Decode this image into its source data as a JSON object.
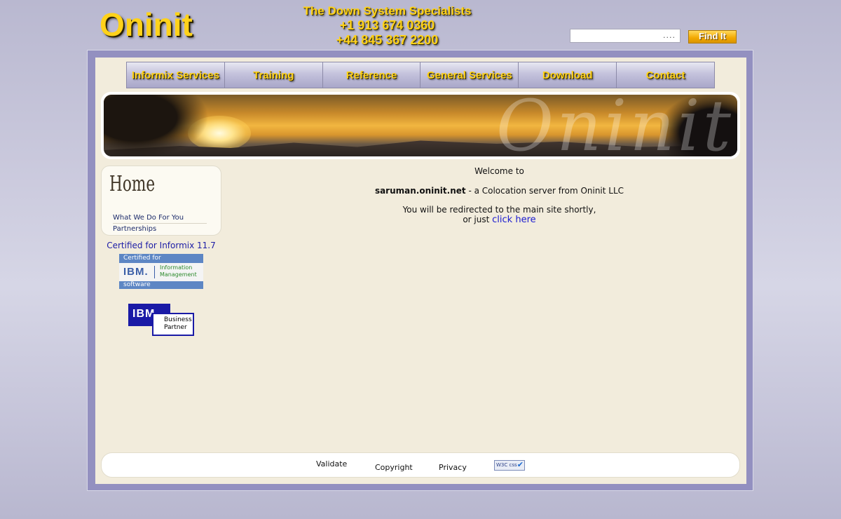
{
  "header": {
    "logo_text": "Oninit",
    "tagline": "The Down System Specialists",
    "phone_us": "+1 913 674 0360",
    "phone_uk": "+44 845 367 2200"
  },
  "search": {
    "value": "....",
    "button_label": "Find It"
  },
  "nav": {
    "items": [
      {
        "label": "Informix Services"
      },
      {
        "label": "Training"
      },
      {
        "label": "Reference"
      },
      {
        "label": "General Services"
      },
      {
        "label": "Download"
      },
      {
        "label": "Contact"
      }
    ]
  },
  "banner": {
    "watermark": "Oninit"
  },
  "sidebar": {
    "title": "Home",
    "links": [
      {
        "label": "What We Do For You"
      },
      {
        "label": "Partnerships"
      }
    ],
    "certified_text": "Certified for Informix 11.7",
    "ibm_cert": {
      "top": "Certified for",
      "ibm": "IBM.",
      "product_line1": "Information",
      "product_line2": "Management",
      "bottom": "software"
    },
    "ibm_partner": {
      "ibm": "IBM",
      "line1": "Business",
      "line2": "Partner"
    }
  },
  "main": {
    "welcome": "Welcome to",
    "server_name": "saruman.oninit.net",
    "server_desc": " - a Colocation server from Oninit LLC",
    "redirect_line": "You will be redirected to the main site shortly,",
    "or_just": "or just ",
    "click_here": "click here"
  },
  "footer": {
    "validate": "Validate",
    "copyright": "Copyright",
    "privacy": "Privacy",
    "w3c_badge": "W3C css"
  },
  "colors": {
    "gold": "#ffd21a",
    "frame": "#9390c0",
    "content_bg": "#f2ecdc",
    "link": "#1b1bd0"
  }
}
